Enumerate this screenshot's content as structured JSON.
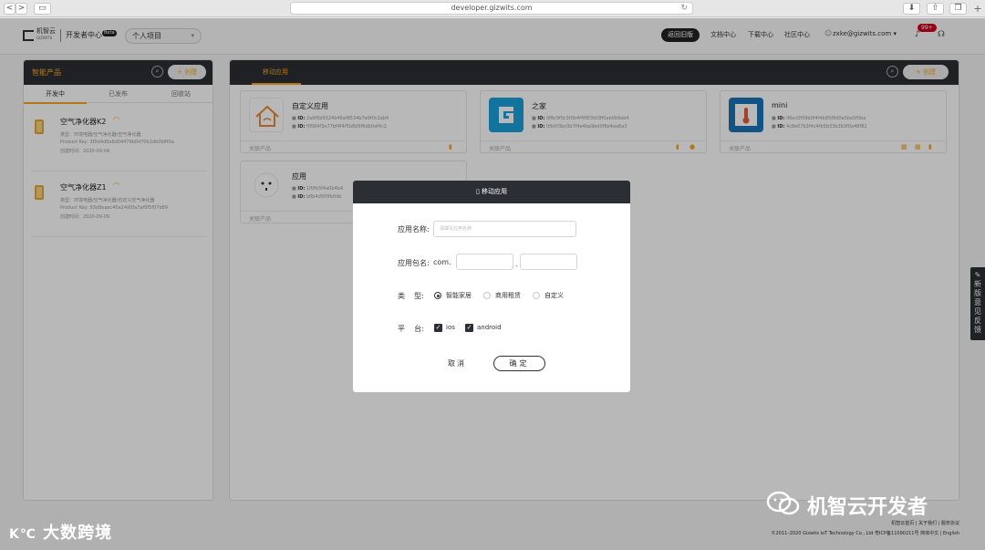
{
  "browser": {
    "url": "developer.gizwits.com",
    "back_glyph": "<",
    "forward_glyph": ">",
    "sidebar_glyph": "▭",
    "reload_glyph": "↻",
    "download_glyph": "⬇",
    "share_glyph": "⇧",
    "tabs_glyph": "❐",
    "new_tab_glyph": "+"
  },
  "header": {
    "logo_text": "机智云",
    "logo_sub": "GIZWITS",
    "dev_center": "开发者中心",
    "beta": "Beta",
    "project_select": "个人项目",
    "back_old": "返回旧版",
    "nav": [
      "文档中心",
      "下载中心",
      "社区中心"
    ],
    "user_email": "zxke@gizwits.com ▾",
    "notification_count": "99+"
  },
  "left_panel": {
    "title": "智能产品",
    "create_label": "+ 创建",
    "tabs": [
      "开发中",
      "已发布",
      "回收站"
    ],
    "products": [
      {
        "name": "空气净化器K2",
        "category": "类型：环境电器/空气净化器/空气净化器",
        "product_key": "Product Key: 3f0d4d0a6d04479b0d70b2db0b8f0a",
        "created": "创建时间：2020-09-04"
      },
      {
        "name": "空气净化器Z1",
        "category": "类型：环境电器/空气净化器/自定义空气净化器",
        "product_key": "Product Key: 93d8eaec40a24d0fa7af0f5f07b89",
        "created": "创建时间：2020-09-09"
      }
    ]
  },
  "right_panel": {
    "tab": "移动应用",
    "create_label": "+ 创建",
    "cards": [
      {
        "name": "自定义应用",
        "id_label": "ID:",
        "id1": "2a9f0b9324b46af8534b7e9f0c2ab4",
        "id2": "f0584f3e77bf4f4f5b8d9f6db0af4c2",
        "foot": "关联产品"
      },
      {
        "name": "之家",
        "id_label": "ID:",
        "id1": "0f8c9f0c3f0b4f4f8f3b08f0ab0b9ab4",
        "id2": "0fb0f3bc0b7f4e4ba9bd0f8e4ea6a3",
        "foot": "关联产品"
      },
      {
        "name": "mini",
        "id_label": "ID:",
        "id1": "06ec0f09b0f4f4b85f8d0a5ba5f0ba",
        "id2": "4c8e07b3f4c4fb5b33b3b3f0a48f82",
        "foot": "关联产品"
      },
      {
        "name": "应用",
        "id_label": "ID:",
        "id1": "1f0fb5f4a0b4b4",
        "id2": "b6b4d5f0fb0db",
        "foot": "关联产品"
      }
    ]
  },
  "feedback_tab": "新版意见反馈",
  "footer": {
    "links": "机智云首页 | 关于我们 | 服务协议",
    "copyright": "©2011–2020 Gizwits IoT Technology Co., Ltd 粤ICP备11090211号 简体中文 | English"
  },
  "watermarks": {
    "left": "大数跨境",
    "right": "机智云开发者"
  },
  "modal": {
    "title": "移动应用",
    "name_label": "应用名称:",
    "name_placeholder": "请填写应用名称",
    "package_label": "应用包名:",
    "package_prefix": "com.",
    "package_dot": ".",
    "type_label": "类    型:",
    "type_options": [
      "智能家居",
      "商用租赁",
      "自定义"
    ],
    "platform_label": "平    台:",
    "platforms": [
      "ios",
      "android"
    ],
    "cancel": "取消",
    "confirm": "确定"
  },
  "colors": {
    "accent": "#f5a623",
    "dark": "#2b2e33",
    "badge": "#d0021b"
  }
}
